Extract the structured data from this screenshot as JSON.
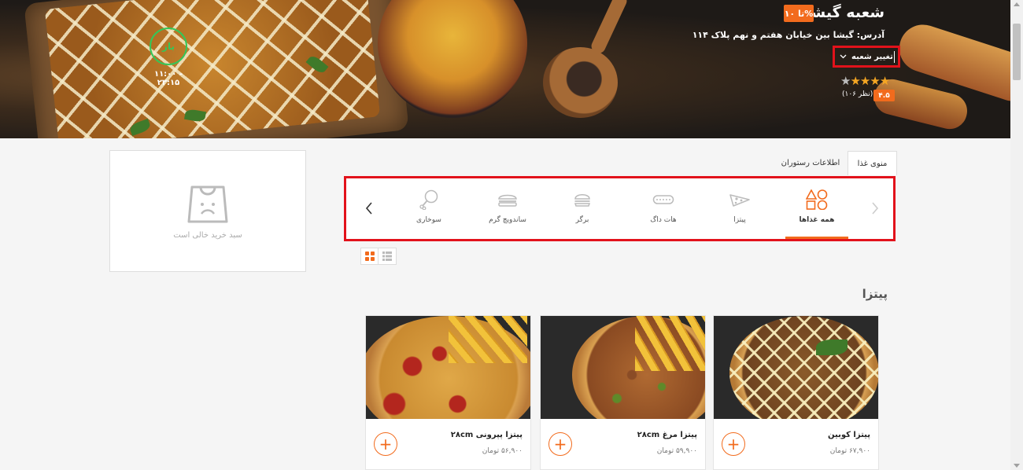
{
  "colors": {
    "accent": "#f26b1d",
    "highlight_border": "#e2121b",
    "open_status": "#34c759",
    "star": "#f5a623"
  },
  "hero": {
    "open_status": "باز",
    "open_hours": "۱۱:۰۰ - ۲۳:۱۵",
    "branch_title": "شعبه گیشا",
    "discount": "تا ۱۰%",
    "address": "آدرس: گیشا بین خیابان هفتم و نهم پلاک ۱۱۴",
    "change_branch": "تغییر شعبه",
    "rating_stars": 4.5,
    "rating_value": "۴.۵",
    "rating_count": "(۱۰۶ نظر)"
  },
  "cart": {
    "empty_text": "سبد خرید خالی است",
    "icon": "shopping-bag-sad-icon"
  },
  "tabs": [
    {
      "label": "منوی غذا",
      "active": true
    },
    {
      "label": "اطلاعات رستوران",
      "active": false
    }
  ],
  "categories": [
    {
      "label": "همه غذاها",
      "icon": "all-foods-shapes-icon",
      "active": true
    },
    {
      "label": "پیتزا",
      "icon": "pizza-slice-icon",
      "active": false
    },
    {
      "label": "هات داگ",
      "icon": "hotdog-icon",
      "active": false
    },
    {
      "label": "برگر",
      "icon": "burger-icon",
      "active": false
    },
    {
      "label": "ساندویچ گرم",
      "icon": "hot-sandwich-icon",
      "active": false
    },
    {
      "label": "سوخاری",
      "icon": "fried-chicken-icon",
      "active": false
    }
  ],
  "section": {
    "title": "پیتزا"
  },
  "products": [
    {
      "name": "پیتزا کوبین",
      "price": "۶۷,۹۰۰ تومان"
    },
    {
      "name": "پیتزا مرغ ۲۸cm",
      "price": "۵۹,۹۰۰ تومان"
    },
    {
      "name": "پیتزا پپرونی ۲۸cm",
      "price": "۵۶,۹۰۰ تومان"
    }
  ]
}
